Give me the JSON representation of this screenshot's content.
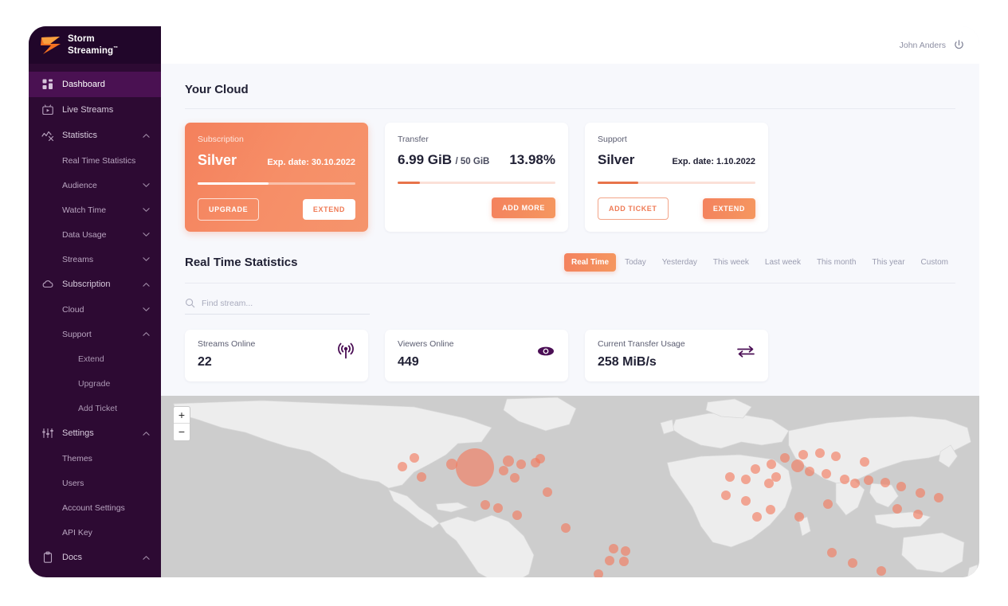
{
  "brand": {
    "name_line1": "Storm",
    "name_line2": "Streaming",
    "tm": "™",
    "logo_icon": "storm-bolt-icon",
    "accent": "#f4825e",
    "sidebar_bg": "#2d0a33"
  },
  "topbar": {
    "username": "John Anders",
    "power_icon": "power-icon"
  },
  "sidebar": {
    "items": [
      {
        "label": "Dashboard",
        "icon": "dashboard-grid-icon",
        "level": 0,
        "active": true,
        "chevron": ""
      },
      {
        "label": "Live Streams",
        "icon": "video-box-icon",
        "level": 0,
        "active": false,
        "chevron": ""
      },
      {
        "label": "Statistics",
        "icon": "statistics-chart-icon",
        "level": 0,
        "active": false,
        "chevron": "up"
      },
      {
        "label": "Real Time Statistics",
        "icon": "",
        "level": 1,
        "active": false,
        "chevron": ""
      },
      {
        "label": "Audience",
        "icon": "",
        "level": 1,
        "active": false,
        "chevron": "down"
      },
      {
        "label": "Watch Time",
        "icon": "",
        "level": 1,
        "active": false,
        "chevron": "down"
      },
      {
        "label": "Data Usage",
        "icon": "",
        "level": 1,
        "active": false,
        "chevron": "down"
      },
      {
        "label": "Streams",
        "icon": "",
        "level": 1,
        "active": false,
        "chevron": "down"
      },
      {
        "label": "Subscription",
        "icon": "cloud-icon",
        "level": 0,
        "active": false,
        "chevron": "up"
      },
      {
        "label": "Cloud",
        "icon": "",
        "level": 1,
        "active": false,
        "chevron": "down"
      },
      {
        "label": "Support",
        "icon": "",
        "level": 1,
        "active": false,
        "chevron": "up"
      },
      {
        "label": "Extend",
        "icon": "",
        "level": 2,
        "active": false,
        "chevron": ""
      },
      {
        "label": "Upgrade",
        "icon": "",
        "level": 2,
        "active": false,
        "chevron": ""
      },
      {
        "label": "Add Ticket",
        "icon": "",
        "level": 2,
        "active": false,
        "chevron": ""
      },
      {
        "label": "Settings",
        "icon": "sliders-icon",
        "level": 0,
        "active": false,
        "chevron": "up"
      },
      {
        "label": "Themes",
        "icon": "",
        "level": 1,
        "active": false,
        "chevron": ""
      },
      {
        "label": "Users",
        "icon": "",
        "level": 1,
        "active": false,
        "chevron": ""
      },
      {
        "label": "Account Settings",
        "icon": "",
        "level": 1,
        "active": false,
        "chevron": ""
      },
      {
        "label": "API Key",
        "icon": "",
        "level": 1,
        "active": false,
        "chevron": ""
      },
      {
        "label": "Docs",
        "icon": "clipboard-icon",
        "level": 0,
        "active": false,
        "chevron": "up"
      }
    ]
  },
  "your_cloud": {
    "title": "Your Cloud",
    "cards": [
      {
        "label": "Subscription",
        "plan": "Silver",
        "exp_date": "Exp. date: 30.10.2022",
        "progress_pct": 45,
        "btn_left": "UPGRADE",
        "btn_right": "EXTEND"
      },
      {
        "label": "Transfer",
        "used": "6.99 GiB",
        "total": "/ 50 GiB",
        "percent": "13.98%",
        "progress_pct": 13.98,
        "btn_right": "ADD MORE"
      },
      {
        "label": "Support",
        "plan": "Silver",
        "exp_date": "Exp. date: 1.10.2022",
        "progress_pct": 26,
        "btn_left": "ADD TICKET",
        "btn_right": "EXTEND"
      }
    ]
  },
  "real_time": {
    "title": "Real Time Statistics",
    "range_tabs": [
      {
        "label": "Real Time",
        "active": true
      },
      {
        "label": "Today",
        "active": false
      },
      {
        "label": "Yesterday",
        "active": false
      },
      {
        "label": "This week",
        "active": false
      },
      {
        "label": "Last week",
        "active": false
      },
      {
        "label": "This month",
        "active": false
      },
      {
        "label": "This year",
        "active": false
      },
      {
        "label": "Custom",
        "active": false
      }
    ],
    "search": {
      "placeholder": "Find stream...",
      "value": "",
      "icon": "search-icon"
    },
    "stats": [
      {
        "label": "Streams Online",
        "value": "22",
        "icon": "broadcast-icon"
      },
      {
        "label": "Viewers Online",
        "value": "449",
        "icon": "eye-icon"
      },
      {
        "label": "Current Transfer Usage",
        "value": "258 MiB/s",
        "icon": "transfer-arrows-icon"
      }
    ]
  },
  "map": {
    "zoom_in": "+",
    "zoom_out": "−",
    "bubble_color": "#f4775a",
    "ocean_color": "#cdcdcd",
    "land_color": "#ededed",
    "bubbles": [
      {
        "x": 31.0,
        "y": 33.0,
        "r": 6
      },
      {
        "x": 29.5,
        "y": 38.0,
        "r": 6
      },
      {
        "x": 31.8,
        "y": 43.5,
        "r": 6
      },
      {
        "x": 35.5,
        "y": 36.5,
        "r": 7
      },
      {
        "x": 38.4,
        "y": 38.5,
        "r": 24
      },
      {
        "x": 42.5,
        "y": 35.0,
        "r": 7
      },
      {
        "x": 41.9,
        "y": 40.0,
        "r": 6
      },
      {
        "x": 44.0,
        "y": 36.5,
        "r": 6
      },
      {
        "x": 45.8,
        "y": 35.8,
        "r": 6
      },
      {
        "x": 46.3,
        "y": 33.5,
        "r": 6
      },
      {
        "x": 43.2,
        "y": 44.0,
        "r": 6
      },
      {
        "x": 47.2,
        "y": 51.5,
        "r": 6
      },
      {
        "x": 39.6,
        "y": 58.5,
        "r": 6
      },
      {
        "x": 41.2,
        "y": 60.0,
        "r": 6
      },
      {
        "x": 43.5,
        "y": 64.0,
        "r": 6
      },
      {
        "x": 49.5,
        "y": 70.5,
        "r": 6
      },
      {
        "x": 55.3,
        "y": 81.5,
        "r": 6
      },
      {
        "x": 56.8,
        "y": 83.0,
        "r": 6
      },
      {
        "x": 54.8,
        "y": 88.0,
        "r": 6
      },
      {
        "x": 56.6,
        "y": 88.5,
        "r": 6
      },
      {
        "x": 53.5,
        "y": 95.5,
        "r": 6
      },
      {
        "x": 69.5,
        "y": 43.5,
        "r": 6
      },
      {
        "x": 71.5,
        "y": 44.5,
        "r": 6
      },
      {
        "x": 74.3,
        "y": 47.0,
        "r": 6
      },
      {
        "x": 75.2,
        "y": 43.5,
        "r": 6
      },
      {
        "x": 72.6,
        "y": 39.0,
        "r": 6
      },
      {
        "x": 74.6,
        "y": 36.5,
        "r": 6
      },
      {
        "x": 76.2,
        "y": 33.0,
        "r": 6
      },
      {
        "x": 78.5,
        "y": 31.5,
        "r": 6
      },
      {
        "x": 80.5,
        "y": 30.5,
        "r": 6
      },
      {
        "x": 82.5,
        "y": 32.5,
        "r": 6
      },
      {
        "x": 86.0,
        "y": 35.5,
        "r": 6
      },
      {
        "x": 77.8,
        "y": 37.5,
        "r": 8
      },
      {
        "x": 79.3,
        "y": 40.5,
        "r": 6
      },
      {
        "x": 81.3,
        "y": 41.5,
        "r": 6
      },
      {
        "x": 83.5,
        "y": 44.5,
        "r": 6
      },
      {
        "x": 84.8,
        "y": 47.0,
        "r": 6
      },
      {
        "x": 86.5,
        "y": 45.0,
        "r": 6
      },
      {
        "x": 88.5,
        "y": 46.5,
        "r": 6
      },
      {
        "x": 90.5,
        "y": 48.5,
        "r": 6
      },
      {
        "x": 92.8,
        "y": 52.0,
        "r": 6
      },
      {
        "x": 95.0,
        "y": 54.5,
        "r": 6
      },
      {
        "x": 69.0,
        "y": 53.0,
        "r": 6
      },
      {
        "x": 71.5,
        "y": 56.0,
        "r": 6
      },
      {
        "x": 74.5,
        "y": 61.0,
        "r": 6
      },
      {
        "x": 72.8,
        "y": 64.5,
        "r": 6
      },
      {
        "x": 78.0,
        "y": 64.5,
        "r": 6
      },
      {
        "x": 81.5,
        "y": 58.0,
        "r": 6
      },
      {
        "x": 90.0,
        "y": 60.5,
        "r": 6
      },
      {
        "x": 92.5,
        "y": 63.5,
        "r": 6
      },
      {
        "x": 82.0,
        "y": 84.0,
        "r": 6
      },
      {
        "x": 84.5,
        "y": 89.5,
        "r": 6
      },
      {
        "x": 88.0,
        "y": 93.5,
        "r": 6
      }
    ]
  }
}
